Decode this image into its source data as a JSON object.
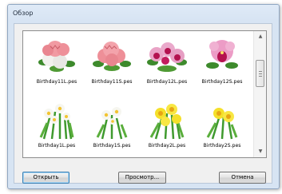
{
  "window": {
    "title": "Обзор"
  },
  "files": [
    {
      "name": "Birthday11L.pes",
      "kind": "pink-carnations-large"
    },
    {
      "name": "Birthday11S.pes",
      "kind": "pink-carnations-small"
    },
    {
      "name": "Birthday12L.pes",
      "kind": "pink-orchids-large"
    },
    {
      "name": "Birthday12S.pes",
      "kind": "pink-orchid-small"
    },
    {
      "name": "Birthday1L.pes",
      "kind": "white-daffodils-large"
    },
    {
      "name": "Birthday1S.pes",
      "kind": "white-daffodils-small"
    },
    {
      "name": "Birthday2L.pes",
      "kind": "yellow-flowers-large"
    },
    {
      "name": "Birthday2S.pes",
      "kind": "yellow-flowers-small"
    }
  ],
  "buttons": {
    "open": "Открыть",
    "preview": "Просмотр...",
    "cancel": "Отмена"
  },
  "icons": {
    "scroll_up": "chevron-up-icon",
    "scroll_down": "chevron-down-icon"
  }
}
